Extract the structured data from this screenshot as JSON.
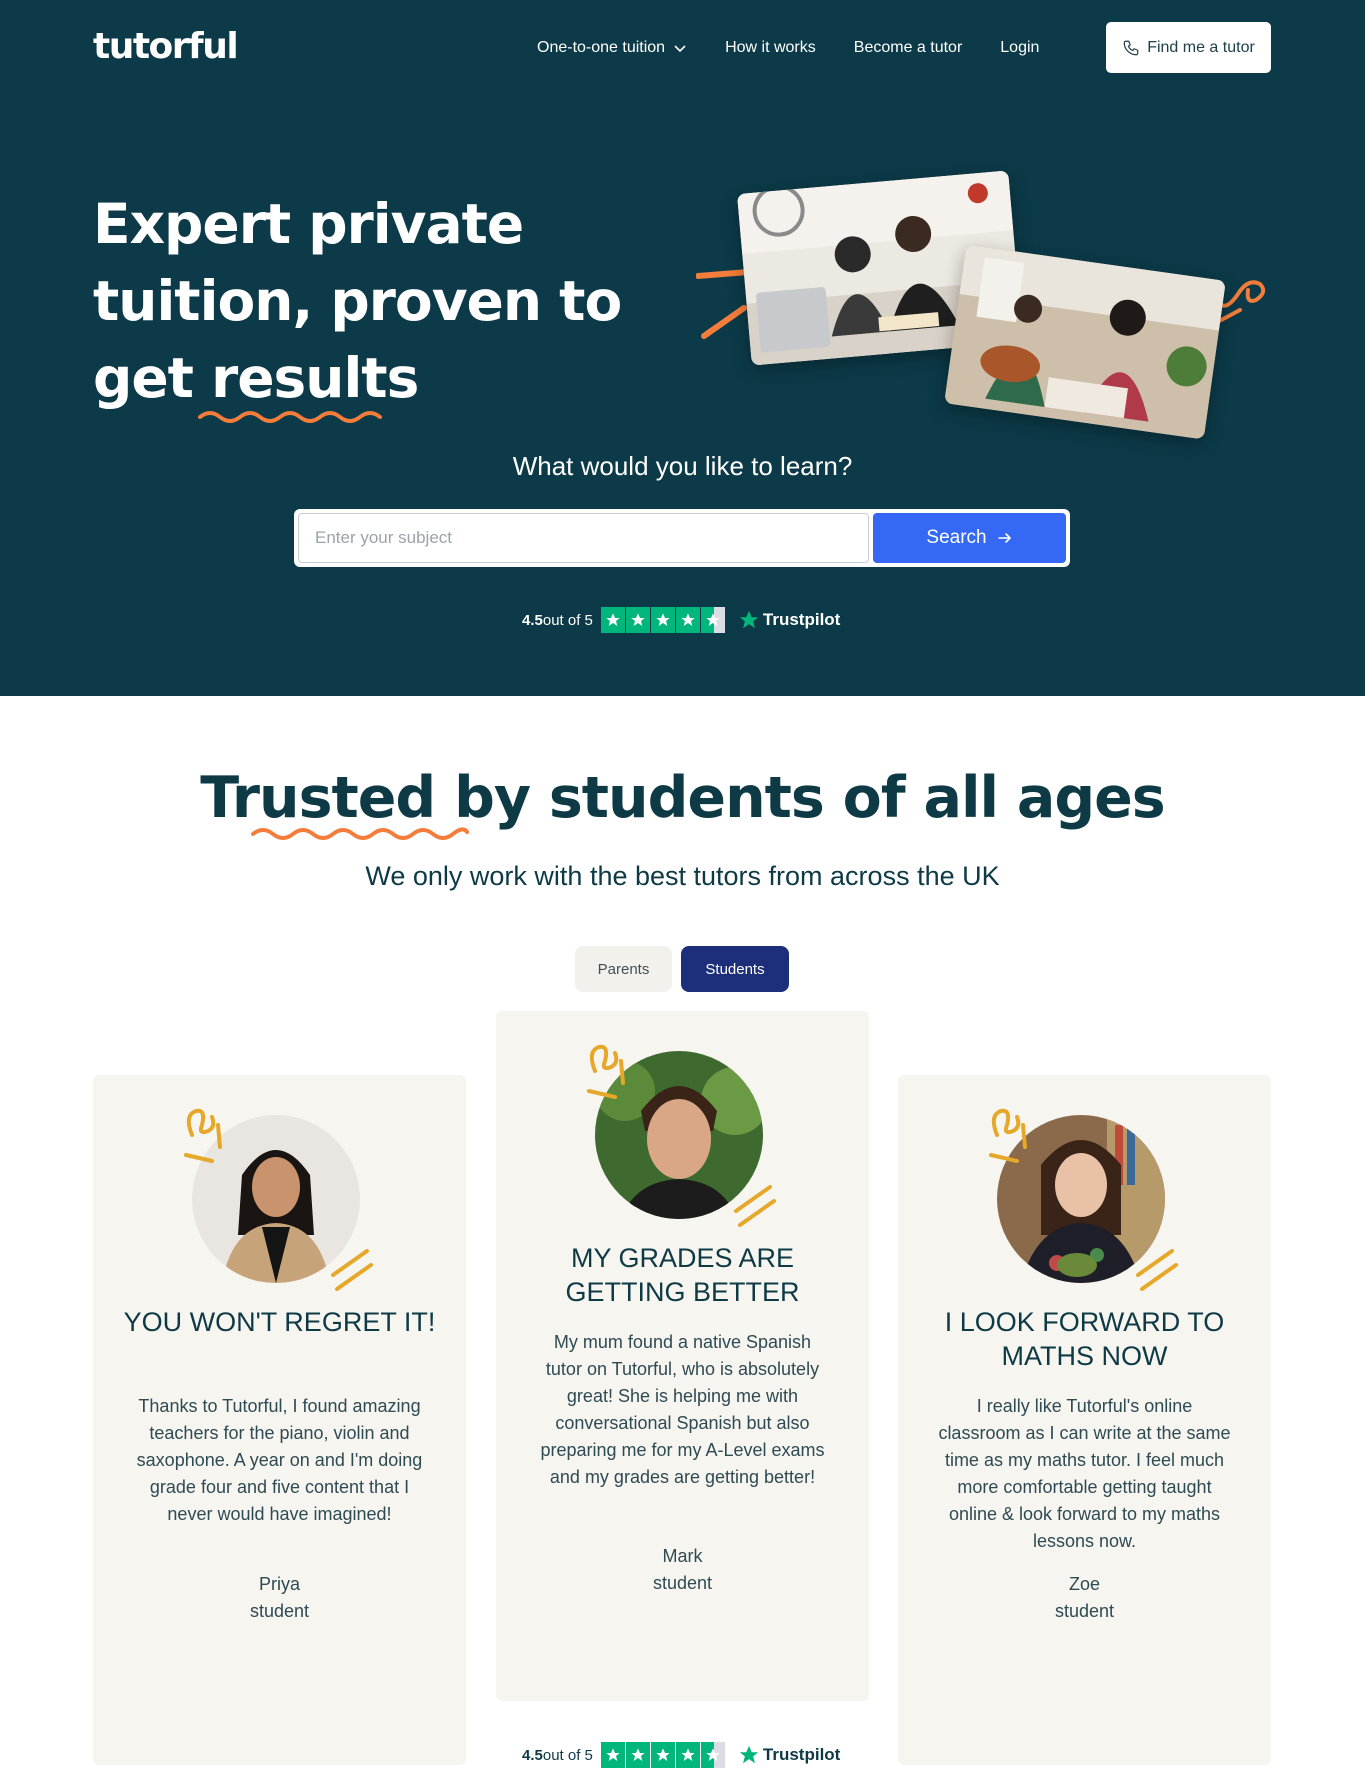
{
  "header": {
    "logo": "tutorful",
    "nav": [
      {
        "label": "One-to-one tuition",
        "has_dropdown": true
      },
      {
        "label": "How it works"
      },
      {
        "label": "Become a tutor"
      },
      {
        "label": "Login"
      }
    ],
    "cta_label": "Find me a tutor"
  },
  "hero": {
    "headline_line1": "Expert private",
    "headline_line2": "tuition, proven to",
    "headline_word_get": "get ",
    "headline_word_results": "results",
    "question": "What would you like to learn?",
    "search_placeholder": "Enter your subject",
    "search_button": "Search"
  },
  "trustpilot": {
    "score": "4.5",
    "out_of": "out of 5",
    "brand": "Trustpilot",
    "rating": 4.5,
    "color": "#00b67a"
  },
  "testimonials": {
    "title_highlight": "Trusted",
    "title_rest": " by students of all ages",
    "subtitle": "We only work with the best tutors from across the UK",
    "tabs": [
      {
        "label": "Parents",
        "active": false
      },
      {
        "label": "Students",
        "active": true
      }
    ],
    "cards": [
      {
        "title": "YOU WON'T REGRET IT!",
        "body": "Thanks to Tutorful, I found amazing teachers for the piano, violin and saxophone. A year on and I'm doing grade four and five content that I never would have imagined!",
        "name": "Priya",
        "role": "student"
      },
      {
        "title": "MY GRADES ARE GETTING BETTER",
        "body": "My mum found a native Spanish tutor on Tutorful, who is absolutely great! She is helping me with conversational Spanish but also preparing me for my A-Level exams and my grades are getting better!",
        "name": "Mark",
        "role": "student"
      },
      {
        "title": "I LOOK FORWARD TO MATHS NOW",
        "body": "I really like Tutorful's online classroom as I can write at the same time as my maths tutor. I feel much more comfortable getting taught online & look forward to my maths lessons now.",
        "name": "Zoe",
        "role": "student"
      }
    ]
  },
  "colors": {
    "hero_bg": "#0c3a48",
    "accent_orange": "#f47d3b",
    "search_blue": "#3569f5",
    "tab_active": "#1d2f7a",
    "card_bg": "#f7f5f0",
    "deco_yellow": "#e6a82a"
  }
}
